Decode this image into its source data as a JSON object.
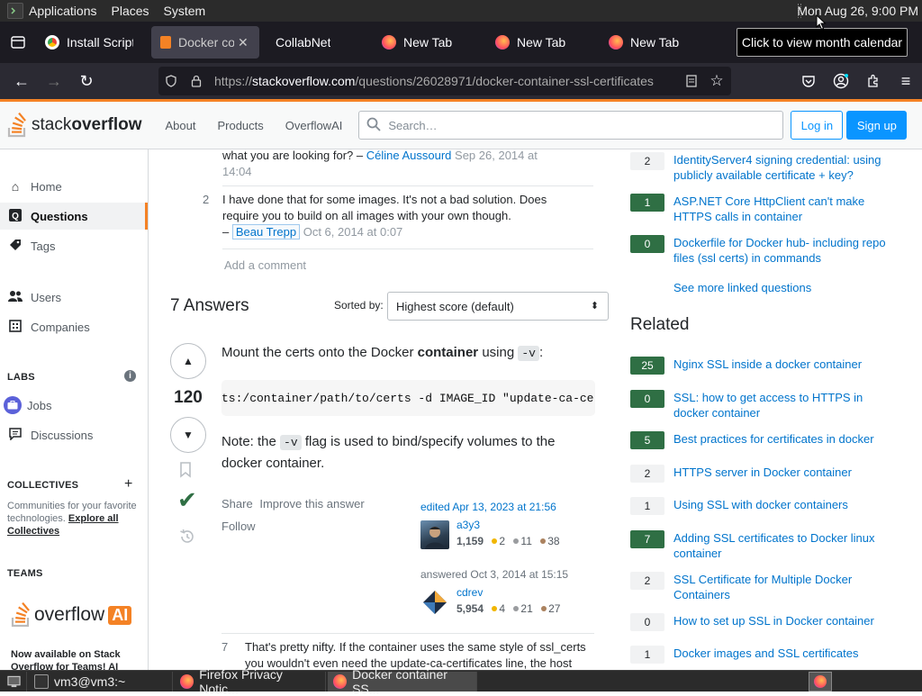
{
  "system_panel": {
    "menus": [
      "Applications",
      "Places",
      "System"
    ],
    "clock": "Mon Aug 26,  9:00 PM"
  },
  "tooltip": "Click to view month calendar",
  "tabs": [
    {
      "title": "Install Script f",
      "icon": "chrome-icon"
    },
    {
      "title": "Docker cont",
      "icon": "stackoverflow-icon",
      "active": true
    },
    {
      "title": "CollabNet",
      "icon": "none"
    },
    {
      "title": "New Tab",
      "icon": "firefox-icon"
    },
    {
      "title": "New Tab",
      "icon": "firefox-icon"
    },
    {
      "title": "New Tab",
      "icon": "firefox-icon"
    }
  ],
  "url": {
    "scheme": "https://",
    "host": "stackoverflow.com",
    "path": "/questions/26028971/docker-container-ssl-certificates"
  },
  "so_header": {
    "logo_a": "stack",
    "logo_b": "overflow",
    "nav": [
      "About",
      "Products",
      "OverflowAI"
    ],
    "search_placeholder": "Search…",
    "login": "Log in",
    "signup": "Sign up"
  },
  "left_nav": {
    "home": "Home",
    "questions": "Questions",
    "tags": "Tags",
    "users": "Users",
    "companies": "Companies",
    "labs": "LABS",
    "jobs": "Jobs",
    "discussions": "Discussions",
    "collectives": "COLLECTIVES",
    "collectives_text": "Communities for your favorite technologies.",
    "explore_link": "Explore all Collectives",
    "teams": "TEAMS",
    "overflow_ai_a": "overflow",
    "overflow_ai_b": "AI",
    "teams_text": "Now available on Stack Overflow for Teams! AI"
  },
  "comments": [
    {
      "number": "",
      "text": "what you are looking for? –",
      "author": "Céline Aussourd",
      "date": "Sep 26, 2014 at",
      "date2": "14:04"
    },
    {
      "number": "2",
      "text1": "I have done that for some images. It's not a bad solution. Does",
      "text2": "require you to build on all images with your own though.",
      "dash": "–",
      "author": "Beau Trepp",
      "date": "Oct 6, 2014 at 0:07"
    }
  ],
  "add_comment": "Add a comment",
  "answers": {
    "count_label": "7 Answers",
    "sort_label": "Sorted by:",
    "sort_value": "Highest score (default)"
  },
  "answer1": {
    "score": "120",
    "intro_a": "Mount the certs onto the Docker",
    "intro_b": "container",
    "intro_c": "using",
    "intro_code": "-v",
    "intro_d": ":",
    "code": "ts:/container/path/to/certs -d IMAGE_ID \"update-ca-ce",
    "note_a": "Note: the",
    "note_code": "-v",
    "note_b": "flag is used to bind/specify volumes to the",
    "note_c": "docker container.",
    "share": "Share",
    "improve": "Improve this answer",
    "follow": "Follow",
    "edited": "edited Apr 13, 2023 at 21:56",
    "editor": {
      "name": "a3y3",
      "rep": "1,159",
      "gold": "2",
      "silver": "11",
      "bronze": "38"
    },
    "answered": "answered Oct 3, 2014 at 15:15",
    "author": {
      "name": "cdrev",
      "rep": "5,954",
      "gold": "4",
      "silver": "21",
      "bronze": "27"
    }
  },
  "comment_after": {
    "number": "7",
    "text1": "That's pretty nifty. If the container uses the same style of ssl_certs",
    "text2": "you wouldn't even need the update-ca-certificates line, the host"
  },
  "linked": [
    {
      "score": "2",
      "title": "IdentityServer4 signing credential: using publicly available certificate + key?"
    },
    {
      "score": "1",
      "title": "ASP.NET Core HttpClient can't make HTTPS calls in container"
    },
    {
      "score": "0",
      "title": "Dockerfile for Docker hub- including repo files (ssl certs) in commands"
    }
  ],
  "see_more": "See more linked questions",
  "related_heading": "Related",
  "related": [
    {
      "score": "25",
      "title": "Nginx SSL inside a docker container"
    },
    {
      "score": "0",
      "title": "SSL: how to get access to HTTPS in docker container"
    },
    {
      "score": "5",
      "title": "Best practices for certificates in docker"
    },
    {
      "score": "2",
      "title": "HTTPS server in Docker container"
    },
    {
      "score": "1",
      "title": "Using SSL with docker containers"
    },
    {
      "score": "7",
      "title": "Adding SSL certificates to Docker linux container"
    },
    {
      "score": "2",
      "title": "SSL Certificate for Multiple Docker Containers"
    },
    {
      "score": "0",
      "title": "How to set up SSL in Docker container"
    },
    {
      "score": "1",
      "title": "Docker images and SSL certificates"
    }
  ],
  "taskbar": [
    {
      "label": "vm3@vm3:~"
    },
    {
      "label": "Firefox Privacy Notic..."
    },
    {
      "label": "Docker container SS..."
    }
  ],
  "colors": {
    "so_orange": "#f48225",
    "so_blue": "#0a95ff",
    "accepted_green": "#2f6f44"
  }
}
